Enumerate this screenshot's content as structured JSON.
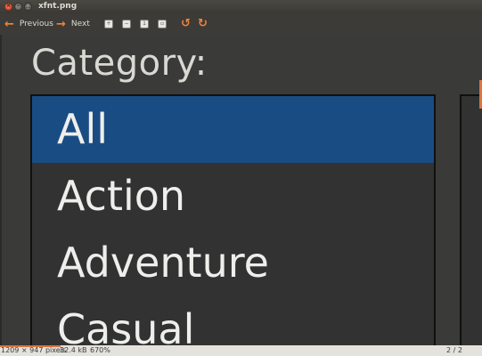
{
  "window": {
    "title": "xfnt.png"
  },
  "toolbar": {
    "previous_label": "Previous",
    "next_label": "Next"
  },
  "image": {
    "category_label": "Category:",
    "list_items": [
      "All",
      "Action",
      "Adventure",
      "Casual"
    ],
    "selected_index": 0
  },
  "status": {
    "dimensions": "1209 × 947 pixels",
    "size": "32.4 kB",
    "zoom": "670%",
    "page": "2 / 2"
  },
  "colors": {
    "accent": "#f0843a",
    "selection": "#1a4c84",
    "window_bg": "#3c3b37"
  }
}
